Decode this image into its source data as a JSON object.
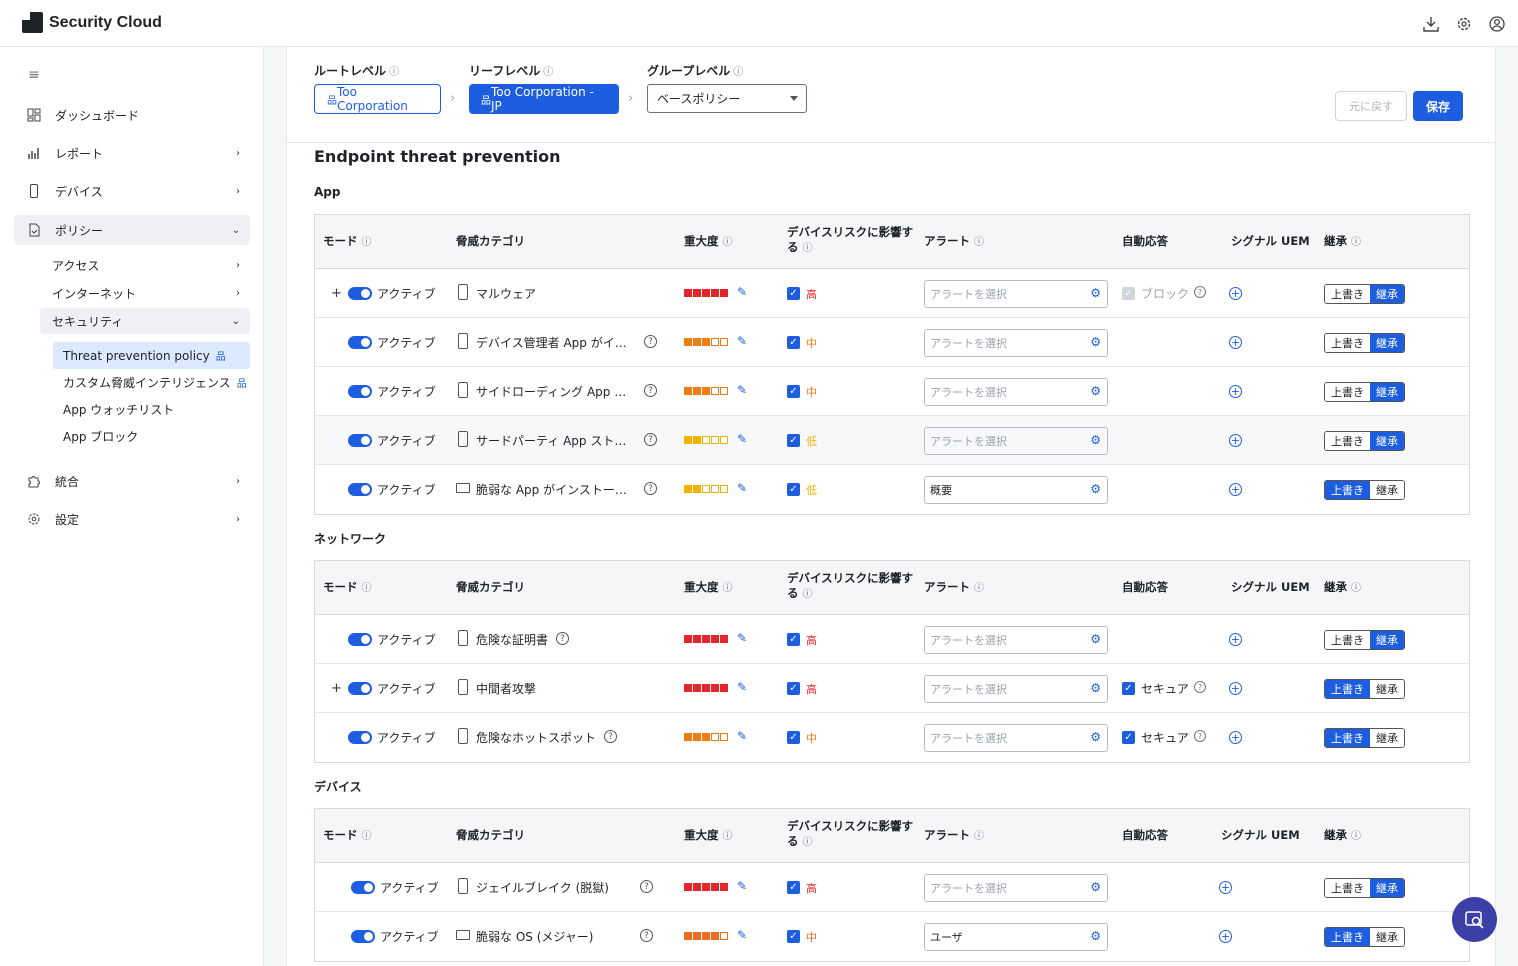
{
  "app": {
    "title": "Security Cloud"
  },
  "nav": {
    "items": [
      "ダッシュボード",
      "レポート",
      "デバイス",
      "ポリシー",
      "統合",
      "設定"
    ],
    "sub": [
      "アクセス",
      "インターネット",
      "セキュリティ"
    ],
    "security": [
      "Threat prevention policy",
      "カスタム脅威インテリジェンス",
      "App ウォッチリスト",
      "App ブロック"
    ]
  },
  "levels": {
    "root_label": "ルートレベル",
    "leaf_label": "リーフレベル",
    "group_label": "グループレベル",
    "root_value": "Too Corporation",
    "leaf_value": "Too Corporation - JP",
    "group_value": "ベースポリシー",
    "revert": "元に戻す",
    "save": "保存"
  },
  "section_title": "Endpoint threat prevention",
  "headers": {
    "mode": "モード",
    "category": "脅威カテゴリ",
    "severity": "重大度",
    "risk1": "デバイスリスクに影響す",
    "risk2": "る",
    "alert": "アラート",
    "auto": "自動応答",
    "uem": "シグナル UEM",
    "inherit": "継承"
  },
  "common": {
    "active": "アクティブ",
    "override": "上書き",
    "inherit": "継承",
    "alert_placeholder": "アラートを選択"
  },
  "groups": [
    {
      "title": "App",
      "rows": [
        {
          "plus": true,
          "cat": "マルウェア",
          "q": false,
          "sev": 5,
          "color": "#e3262b",
          "lvl": "高",
          "alert": "",
          "auto": "ブロック",
          "auto_state": "disabled",
          "mode": "inherit",
          "dev": "phone"
        },
        {
          "plus": false,
          "cat": "デバイス管理者 App がインス…",
          "q": true,
          "sev": 3,
          "color": "#f07c14",
          "lvl": "中",
          "alert": "",
          "auto": "",
          "mode": "inherit",
          "dev": "phone"
        },
        {
          "plus": false,
          "cat": "サイドローディング App がイ…",
          "q": true,
          "sev": 3,
          "color": "#f07c14",
          "lvl": "中",
          "alert": "",
          "auto": "",
          "mode": "inherit",
          "dev": "phone"
        },
        {
          "plus": false,
          "cat": "サードパーティ App ストアが…",
          "q": true,
          "sev": 2,
          "color": "#f0b400",
          "lvl": "低",
          "alert": "",
          "auto": "",
          "mode": "inherit",
          "dev": "phone"
        },
        {
          "plus": false,
          "cat": "脆弱な App がインストールさ…",
          "q": true,
          "sev": 2,
          "color": "#f0b400",
          "lvl": "低",
          "alert": "概要",
          "auto": "",
          "mode": "override",
          "dev": "multi"
        }
      ]
    },
    {
      "title": "ネットワーク",
      "rows": [
        {
          "plus": false,
          "cat": "危険な証明書",
          "q": true,
          "sev": 5,
          "color": "#e3262b",
          "lvl": "高",
          "alert": "",
          "auto": "",
          "mode": "inherit",
          "dev": "phone"
        },
        {
          "plus": true,
          "cat": "中間者攻撃",
          "q": false,
          "sev": 5,
          "color": "#e3262b",
          "lvl": "高",
          "alert": "",
          "auto": "セキュア",
          "auto_state": "on",
          "mode": "override",
          "dev": "phone"
        },
        {
          "plus": false,
          "cat": "危険なホットスポット",
          "q": true,
          "sev": 3,
          "color": "#f07c14",
          "lvl": "中",
          "alert": "",
          "auto": "セキュア",
          "auto_state": "on",
          "mode": "override",
          "dev": "phone"
        }
      ]
    },
    {
      "title": "デバイス",
      "rows": [
        {
          "plus": false,
          "cat": "ジェイルブレイク (脱獄)",
          "q": true,
          "sev": 5,
          "color": "#e3262b",
          "lvl": "高",
          "alert": "",
          "auto": "",
          "mode": "inherit",
          "dev": "phone"
        },
        {
          "plus": false,
          "cat": "脆弱な OS (メジャー)",
          "q": true,
          "sev": 4,
          "color": "#f06a1f",
          "lvl": "中",
          "alert": "ユーザ",
          "auto": "",
          "mode": "override",
          "dev": "multi"
        }
      ]
    }
  ]
}
